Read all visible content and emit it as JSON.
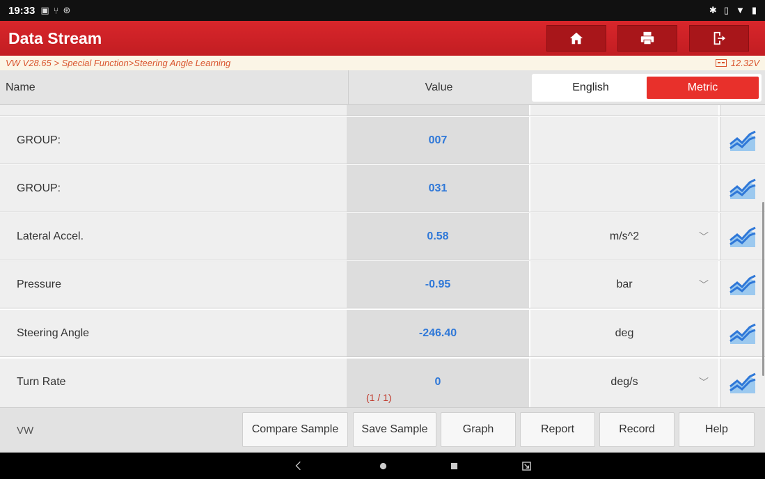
{
  "status_bar": {
    "time": "19:33"
  },
  "title_bar": {
    "title": "Data Stream"
  },
  "breadcrumb": {
    "path": "VW V28.65 > Special Function>Steering Angle Learning",
    "voltage": "12.32V"
  },
  "header": {
    "name_label": "Name",
    "value_label": "Value",
    "unit_options": [
      "English",
      "Metric"
    ],
    "selected_unit": "Metric"
  },
  "rows": [
    {
      "name": "GROUP:",
      "value": "007",
      "unit": ""
    },
    {
      "name": "GROUP:",
      "value": "031",
      "unit": ""
    },
    {
      "name": "Lateral Accel.",
      "value": "0.58",
      "unit": "m/s^2"
    },
    {
      "name": "Pressure",
      "value": "-0.95",
      "unit": "bar"
    },
    {
      "name": "Steering Angle",
      "value": "-246.40",
      "unit": "deg"
    },
    {
      "name": "Turn Rate",
      "value": "0",
      "unit": "deg/s"
    }
  ],
  "page_indicator": "(1 / 1)",
  "toolbar": {
    "brand": "VW",
    "buttons": [
      "Compare Sample",
      "Save Sample",
      "Graph",
      "Report",
      "Record",
      "Help"
    ]
  },
  "colors": {
    "title_red": "#c21d22",
    "value_blue": "#2f78d8",
    "active_unit": "#e8302b",
    "breadcrumb": "#d9542d"
  },
  "icons": {
    "title_buttons": [
      "home-icon",
      "print-icon",
      "exit-icon"
    ],
    "row_action": "graph-trend-icon",
    "nav": [
      "back-icon",
      "home-circle-icon",
      "recents-icon",
      "screenshot-icon"
    ]
  }
}
